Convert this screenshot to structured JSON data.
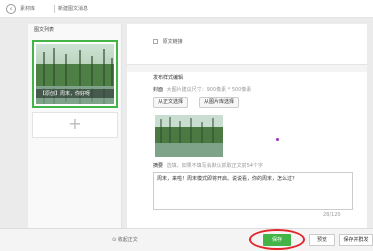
{
  "header": {
    "back_label": "‹",
    "breadcrumb_home": "素材库",
    "breadcrumb_current": "新建图文消息"
  },
  "sidebar": {
    "title": "图文列表",
    "article_caption": "【原创】周末，你好呀",
    "add_label": "+"
  },
  "main": {
    "original_link_label": "原文链接",
    "settings_title": "发布样式编辑",
    "cover_label": "封面",
    "cover_hint": "大图片建议尺寸：900像素 * 500像素",
    "choose_from_body": "从正文选择",
    "choose_from_library": "从图片库选择",
    "summary_label": "摘要",
    "summary_hint": "选填，如果不填写会默认抓取正文前54个字",
    "summary_text": "周末，来啦！周末模式即将开启。说说看，你的周末，怎么过？",
    "summary_count": "28/120"
  },
  "footer": {
    "collapse_body": "收起正文",
    "save": "保存",
    "preview": "预览",
    "save_and_send": "保存并群发"
  },
  "colors": {
    "accent": "#43b548",
    "highlight": "#e2262b",
    "annotation_arrow": "#a030c0"
  }
}
